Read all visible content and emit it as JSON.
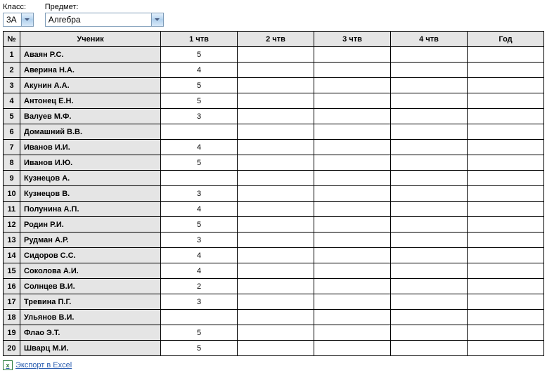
{
  "filters": {
    "class_label": "Класс:",
    "class_value": "3А",
    "subject_label": "Предмет:",
    "subject_value": "Алгебра"
  },
  "headers": {
    "num": "№",
    "student": "Ученик",
    "q1": "1 чтв",
    "q2": "2 чтв",
    "q3": "3 чтв",
    "q4": "4 чтв",
    "year": "Год"
  },
  "rows": [
    {
      "n": "1",
      "name": "Аваян Р.С.",
      "q1": "5",
      "q2": "",
      "q3": "",
      "q4": "",
      "year": ""
    },
    {
      "n": "2",
      "name": "Аверина Н.А.",
      "q1": "4",
      "q2": "",
      "q3": "",
      "q4": "",
      "year": ""
    },
    {
      "n": "3",
      "name": "Акунин А.А.",
      "q1": "5",
      "q2": "",
      "q3": "",
      "q4": "",
      "year": ""
    },
    {
      "n": "4",
      "name": "Антонец Е.Н.",
      "q1": "5",
      "q2": "",
      "q3": "",
      "q4": "",
      "year": ""
    },
    {
      "n": "5",
      "name": "Валуев М.Ф.",
      "q1": "3",
      "q2": "",
      "q3": "",
      "q4": "",
      "year": ""
    },
    {
      "n": "6",
      "name": "Домашний В.В.",
      "q1": "",
      "q2": "",
      "q3": "",
      "q4": "",
      "year": ""
    },
    {
      "n": "7",
      "name": "Иванов И.И.",
      "q1": "4",
      "q2": "",
      "q3": "",
      "q4": "",
      "year": ""
    },
    {
      "n": "8",
      "name": "Иванов И.Ю.",
      "q1": "5",
      "q2": "",
      "q3": "",
      "q4": "",
      "year": ""
    },
    {
      "n": "9",
      "name": "Кузнецов А.",
      "q1": "",
      "q2": "",
      "q3": "",
      "q4": "",
      "year": ""
    },
    {
      "n": "10",
      "name": "Кузнецов В.",
      "q1": "3",
      "q2": "",
      "q3": "",
      "q4": "",
      "year": ""
    },
    {
      "n": "11",
      "name": "Полунина А.П.",
      "q1": "4",
      "q2": "",
      "q3": "",
      "q4": "",
      "year": ""
    },
    {
      "n": "12",
      "name": "Родин Р.И.",
      "q1": "5",
      "q2": "",
      "q3": "",
      "q4": "",
      "year": ""
    },
    {
      "n": "13",
      "name": "Рудман А.Р.",
      "q1": "3",
      "q2": "",
      "q3": "",
      "q4": "",
      "year": ""
    },
    {
      "n": "14",
      "name": "Сидоров С.С.",
      "q1": "4",
      "q2": "",
      "q3": "",
      "q4": "",
      "year": ""
    },
    {
      "n": "15",
      "name": "Соколова А.И.",
      "q1": "4",
      "q2": "",
      "q3": "",
      "q4": "",
      "year": ""
    },
    {
      "n": "16",
      "name": "Солнцев В.И.",
      "q1": "2",
      "q2": "",
      "q3": "",
      "q4": "",
      "year": ""
    },
    {
      "n": "17",
      "name": "Тревина П.Г.",
      "q1": "3",
      "q2": "",
      "q3": "",
      "q4": "",
      "year": ""
    },
    {
      "n": "18",
      "name": "Ульянов В.И.",
      "q1": "",
      "q2": "",
      "q3": "",
      "q4": "",
      "year": ""
    },
    {
      "n": "19",
      "name": "Флао Э.Т.",
      "q1": "5",
      "q2": "",
      "q3": "",
      "q4": "",
      "year": ""
    },
    {
      "n": "20",
      "name": "Шварц М.И.",
      "q1": "5",
      "q2": "",
      "q3": "",
      "q4": "",
      "year": ""
    }
  ],
  "export_label": "Экспорт в Excel"
}
